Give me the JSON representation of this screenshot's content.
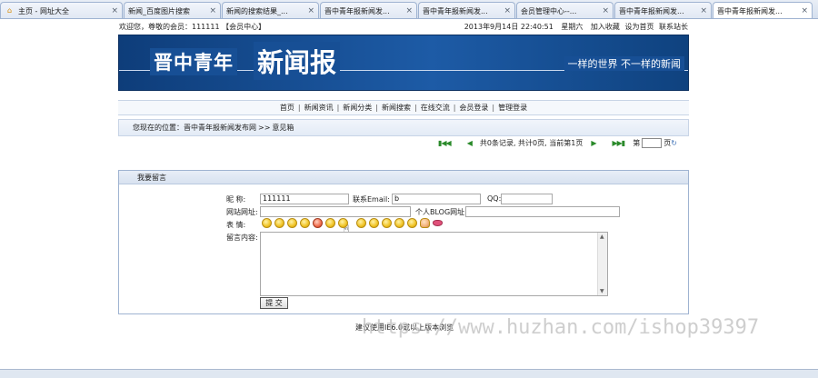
{
  "browser": {
    "tabs": [
      {
        "title": "主页 - 网址大全",
        "icon": "home-icon",
        "active": false
      },
      {
        "title": "新闻_百度图片搜索",
        "icon": "page-icon",
        "active": false
      },
      {
        "title": "新闻的搜索结果_...",
        "icon": "page-icon",
        "active": false
      },
      {
        "title": "晋中青年报新闻发...",
        "icon": "page-icon",
        "active": false
      },
      {
        "title": "晋中青年报新闻发...",
        "icon": "page-icon",
        "active": false
      },
      {
        "title": "会员管理中心--...",
        "icon": "page-icon",
        "active": false
      },
      {
        "title": "晋中青年报新闻发...",
        "icon": "page-icon",
        "active": false
      },
      {
        "title": "晋中青年报新闻发...",
        "icon": "page-icon",
        "active": true
      }
    ]
  },
  "topbar": {
    "welcome": "欢迎您，尊敬的会员：111111 【会员中心】",
    "datetime": "2013年9月14日 22:40:51",
    "weekday": "星期六",
    "links": [
      "加入收藏",
      "设为首页",
      "联系站长"
    ]
  },
  "banner": {
    "name_part1": "晋中青年",
    "name_part2": "新闻报",
    "slogan": "一样的世界 不一样的新闻"
  },
  "nav": {
    "items": [
      "首页",
      "新闻资讯",
      "新闻分类",
      "新闻搜索",
      "在线交流",
      "会员登录",
      "管理登录"
    ]
  },
  "breadcrumb": {
    "prefix": "您现在的位置：",
    "site": "晋中青年报新闻发布网",
    "separator": ">>",
    "current": "意见箱"
  },
  "pager": {
    "summary": "共0条记录, 共计0页, 当前第1页",
    "goto_prefix": "第",
    "goto_suffix": "页"
  },
  "form": {
    "section_title": "我要留言",
    "nickname_label": "昵    称:",
    "nickname_value": "111111",
    "email_label": "联系Email:",
    "email_value": "b",
    "qq_label": "QQ:",
    "qq_value": "",
    "website_label": "网站网址:",
    "website_value": "",
    "blog_label": "个人BLOG网址:",
    "blog_value": "",
    "emotion_label": "表    情:",
    "content_label": "留言内容:",
    "submit_label": "提 交"
  },
  "footer": {
    "text": "建议使用IE6.0或以上版本浏览"
  },
  "watermark": {
    "text": "https://www.huzhan.com/ishop39397"
  }
}
